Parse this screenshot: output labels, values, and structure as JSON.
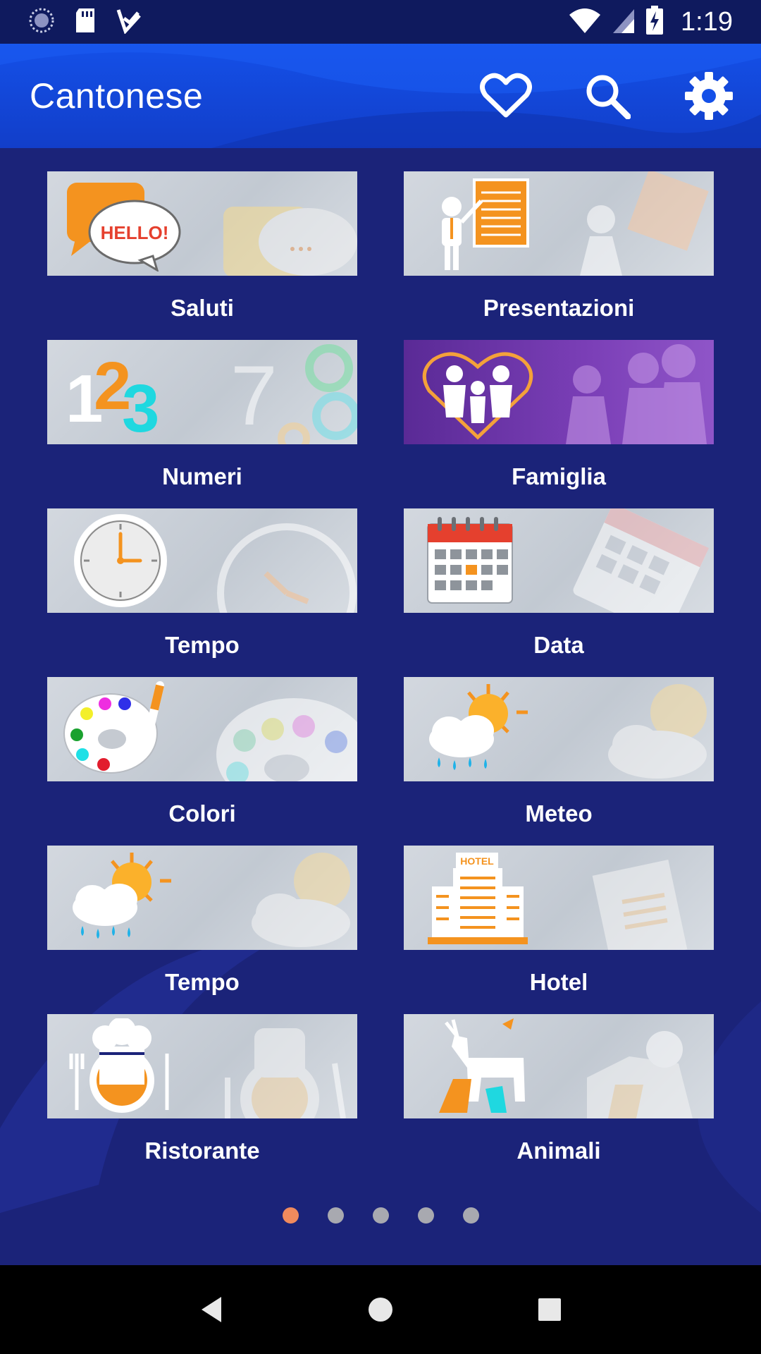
{
  "status_bar": {
    "time": "1:19",
    "left_icons": [
      "loading-icon",
      "sd-card-icon",
      "checkmark-download-icon"
    ],
    "right_icons": [
      "wifi-icon",
      "signal-icon",
      "battery-charging-icon"
    ]
  },
  "app_bar": {
    "title": "Cantonese",
    "actions": [
      "heart-icon",
      "search-icon",
      "gear-icon"
    ]
  },
  "categories": [
    {
      "label": "Saluti",
      "icon": "hello-speech-bubble-icon"
    },
    {
      "label": "Presentazioni",
      "icon": "presentation-board-icon"
    },
    {
      "label": "Numeri",
      "icon": "numbers-123-icon"
    },
    {
      "label": "Famiglia",
      "icon": "family-heart-icon"
    },
    {
      "label": "Tempo",
      "icon": "clock-icon"
    },
    {
      "label": "Data",
      "icon": "calendar-icon"
    },
    {
      "label": "Colori",
      "icon": "paint-palette-icon"
    },
    {
      "label": "Meteo",
      "icon": "sun-cloud-rain-icon"
    },
    {
      "label": "Tempo",
      "icon": "sun-cloud-rain-icon"
    },
    {
      "label": "Hotel",
      "icon": "hotel-building-icon"
    },
    {
      "label": "Ristorante",
      "icon": "chef-plate-icon"
    },
    {
      "label": "Animali",
      "icon": "animals-icon"
    }
  ],
  "pager": {
    "pages": 5,
    "active": 1
  },
  "nav_bar": [
    "back-icon",
    "home-icon",
    "recents-icon"
  ],
  "colors": {
    "background": "#1b2379",
    "app_bar": "#1450e8",
    "accent_orange": "#f08a5d",
    "dot_inactive": "#a8a9b0"
  }
}
